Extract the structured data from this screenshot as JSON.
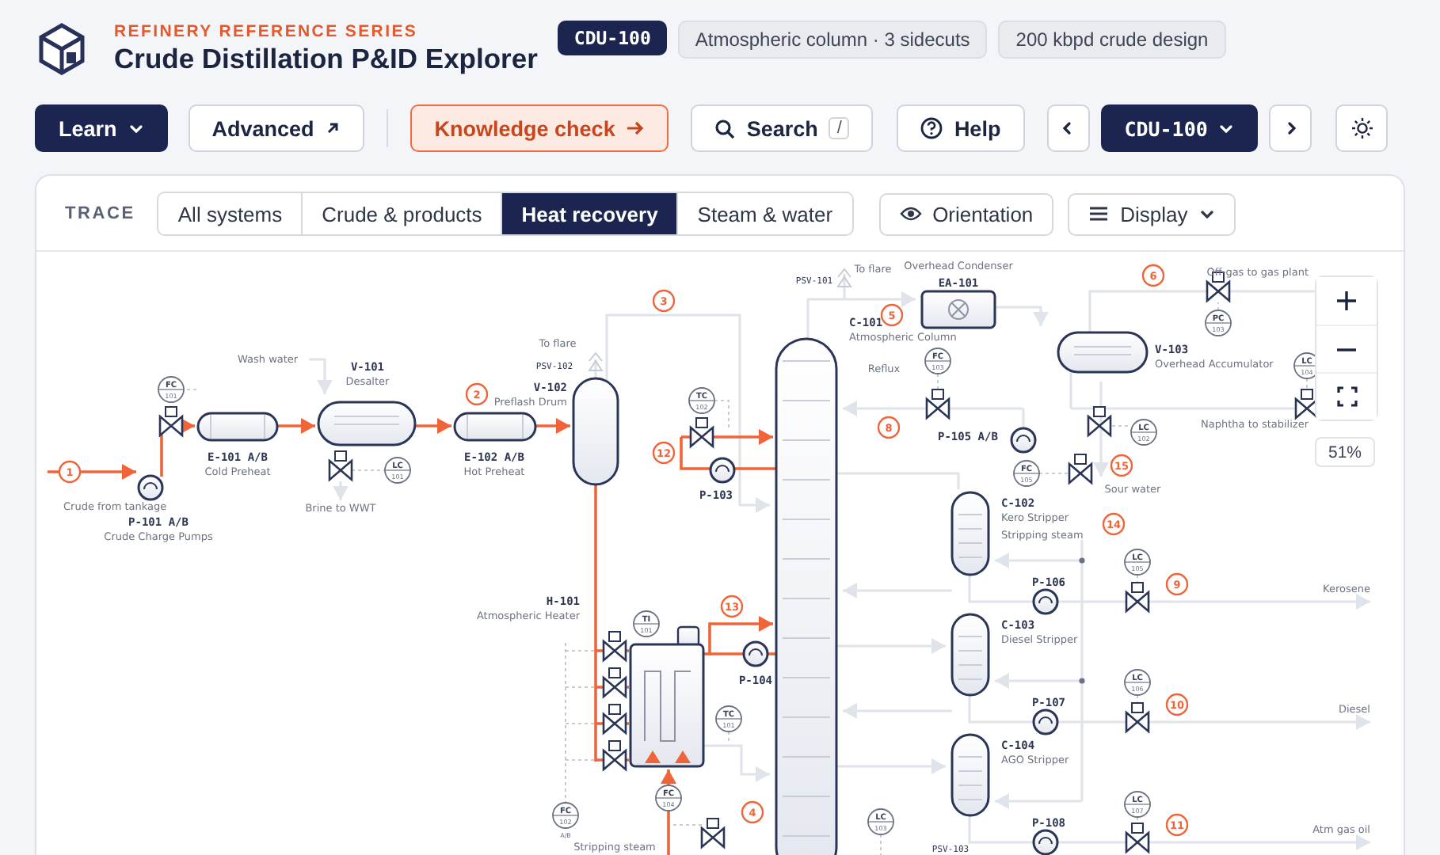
{
  "header": {
    "series": "REFINERY REFERENCE SERIES",
    "title": "Crude Distillation P&ID Explorer",
    "badges": [
      {
        "text": "CDU-100",
        "kind": "unit"
      },
      {
        "text": "Atmospheric column · 3 sidecuts",
        "kind": "info"
      },
      {
        "text": "200 kbpd crude design",
        "kind": "info"
      }
    ]
  },
  "toolbar": {
    "learn": "Learn",
    "advanced": "Advanced",
    "knowledge_check": "Knowledge check",
    "search": {
      "label": "Search",
      "shortcut": "/"
    },
    "help": "Help",
    "unit_selector": "CDU-100"
  },
  "trace": {
    "label": "TRACE",
    "tabs": [
      {
        "label": "All systems",
        "selected": false
      },
      {
        "label": "Crude & products",
        "selected": false
      },
      {
        "label": "Heat recovery",
        "selected": true
      },
      {
        "label": "Steam & water",
        "selected": false
      }
    ],
    "orientation": "Orientation",
    "display": "Display"
  },
  "diagram": {
    "equipment": [
      {
        "tag": "P-101 A/B",
        "name": "Crude Charge Pumps",
        "kind": "pump"
      },
      {
        "tag": "E-101 A/B",
        "name": "Cold Preheat",
        "kind": "exchanger"
      },
      {
        "tag": "V-101",
        "name": "Desalter",
        "kind": "vessel_h"
      },
      {
        "tag": "E-102 A/B",
        "name": "Hot Preheat",
        "kind": "exchanger"
      },
      {
        "tag": "V-102",
        "name": "Preflash Drum",
        "kind": "vessel_v"
      },
      {
        "tag": "C-101",
        "name": "Atmospheric Column",
        "kind": "column"
      },
      {
        "tag": "EA-101",
        "name": "Overhead Condenser",
        "kind": "aircooler"
      },
      {
        "tag": "V-103",
        "name": "Overhead Accumulator",
        "kind": "vessel_h"
      },
      {
        "tag": "P-105 A/B",
        "kind": "pump"
      },
      {
        "tag": "C-102",
        "name": "Kero Stripper",
        "kind": "stripper"
      },
      {
        "tag": "C-103",
        "name": "Diesel Stripper",
        "kind": "stripper"
      },
      {
        "tag": "C-104",
        "name": "AGO Stripper",
        "kind": "stripper"
      },
      {
        "tag": "P-103",
        "kind": "pump"
      },
      {
        "tag": "P-104",
        "kind": "pump"
      },
      {
        "tag": "P-106",
        "kind": "pump"
      },
      {
        "tag": "P-107",
        "kind": "pump"
      },
      {
        "tag": "P-108",
        "kind": "pump"
      },
      {
        "tag": "H-101",
        "name": "Atmospheric Heater",
        "kind": "heater"
      }
    ],
    "labels": [
      {
        "text": "Crude from tankage",
        "kind": "note"
      },
      {
        "text": "Wash water",
        "kind": "note"
      },
      {
        "text": "Brine to WWT",
        "kind": "note"
      },
      {
        "text": "To flare",
        "kind": "note"
      },
      {
        "text": "PSV-102",
        "kind": "tag"
      },
      {
        "text": "To flare",
        "kind": "note"
      },
      {
        "text": "PSV-101",
        "kind": "tag"
      },
      {
        "text": "Reflux",
        "kind": "note"
      },
      {
        "text": "Off-gas to gas plant",
        "kind": "note"
      },
      {
        "text": "Naphtha to stabilizer",
        "kind": "note"
      },
      {
        "text": "Sour water",
        "kind": "note"
      },
      {
        "text": "Stripping steam",
        "kind": "note"
      },
      {
        "text": "Kerosene",
        "kind": "note"
      },
      {
        "text": "Diesel",
        "kind": "note"
      },
      {
        "text": "Atm gas oil",
        "kind": "note"
      },
      {
        "text": "Stripping steam",
        "kind": "note"
      },
      {
        "text": "PSV-103",
        "kind": "tag"
      }
    ],
    "instruments": [
      {
        "function": "FC",
        "number": "101"
      },
      {
        "function": "LC",
        "number": "101"
      },
      {
        "function": "TC",
        "number": "102"
      },
      {
        "function": "FC",
        "number": "103"
      },
      {
        "function": "PC",
        "number": "103"
      },
      {
        "function": "LC",
        "number": "104"
      },
      {
        "function": "LC",
        "number": "102"
      },
      {
        "function": "FC",
        "number": "105"
      },
      {
        "function": "LC",
        "number": "105"
      },
      {
        "function": "LC",
        "number": "106"
      },
      {
        "function": "LC",
        "number": "107"
      },
      {
        "function": "TI",
        "number": "101"
      },
      {
        "function": "TC",
        "number": "101"
      },
      {
        "function": "FC",
        "number": "104"
      },
      {
        "function": "FC",
        "number": "102",
        "suffix": "A/B"
      },
      {
        "function": "LC",
        "number": "103"
      }
    ],
    "streams": [
      "1",
      "2",
      "3",
      "4",
      "5",
      "6",
      "8",
      "9",
      "10",
      "11",
      "12",
      "13",
      "14",
      "15"
    ],
    "zoom_level": "51%"
  }
}
